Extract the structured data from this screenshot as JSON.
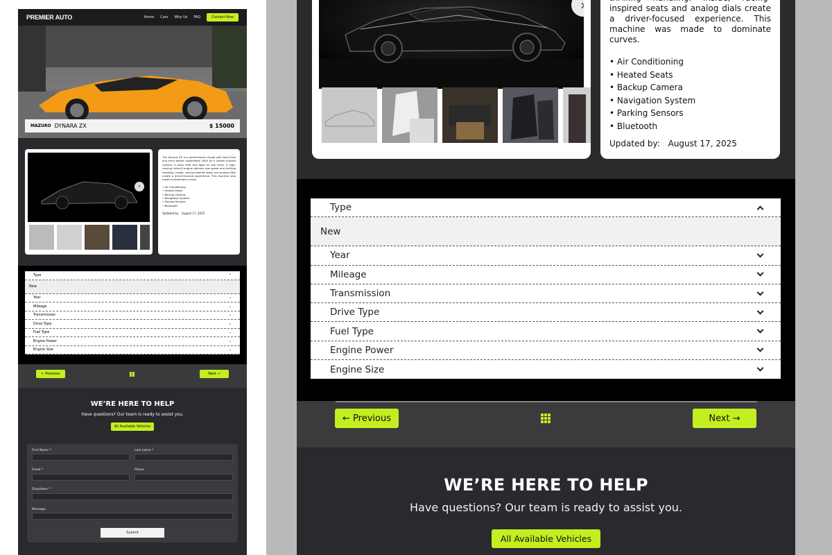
{
  "brand": {
    "logo": "PREMIER AUTO",
    "accent": "#c3ee20"
  },
  "nav": {
    "links": [
      "Home",
      "Cars",
      "Why Us",
      "FAQ"
    ],
    "cta": "Contact Now"
  },
  "listing": {
    "make": "MAZURO",
    "model": "DYNARA ZX",
    "price": "$ 15000"
  },
  "details": {
    "description": "The Dynara ZX is a performance coupe with bold lines and even bolder capabilities. Built on a carbon-infused chassis, it stays light and agile on any track. A high-revving inline-6 engine delivers raw speed and thrilling handling. Inside, racing-inspired seats and analog dials create a driver-focused experience. This machine was made to dominate curves.",
    "description_visible": "thrilling handling. Inside, racing-inspired seats and analog dials create a driver-focused experience. This machine was made to dominate curves.",
    "features": [
      "Air Conditioning",
      "Heated Seats",
      "Backup Camera",
      "Navigation System",
      "Parking Sensors",
      "Bluetooth"
    ],
    "updated_label": "Updated by:",
    "updated_date": "August 17, 2025"
  },
  "filters": {
    "expanded": {
      "label": "Type",
      "selected": "New"
    },
    "items": [
      "Year",
      "Mileage",
      "Transmission",
      "Drive Type",
      "Fuel Type",
      "Engine Power",
      "Engine Size"
    ]
  },
  "pager": {
    "prev": "← Previous",
    "next": "Next →"
  },
  "help": {
    "title": "WE’RE HERE TO HELP",
    "subtitle": "Have questions? Our team is ready to assist you.",
    "button": "All Available Vehicles"
  },
  "form": {
    "first_name": "First Name *",
    "last_name": "Last name *",
    "email": "Email *",
    "phone": "Phone",
    "dropdown": "Dropdown *",
    "message": "Message",
    "submit": "Submit"
  }
}
